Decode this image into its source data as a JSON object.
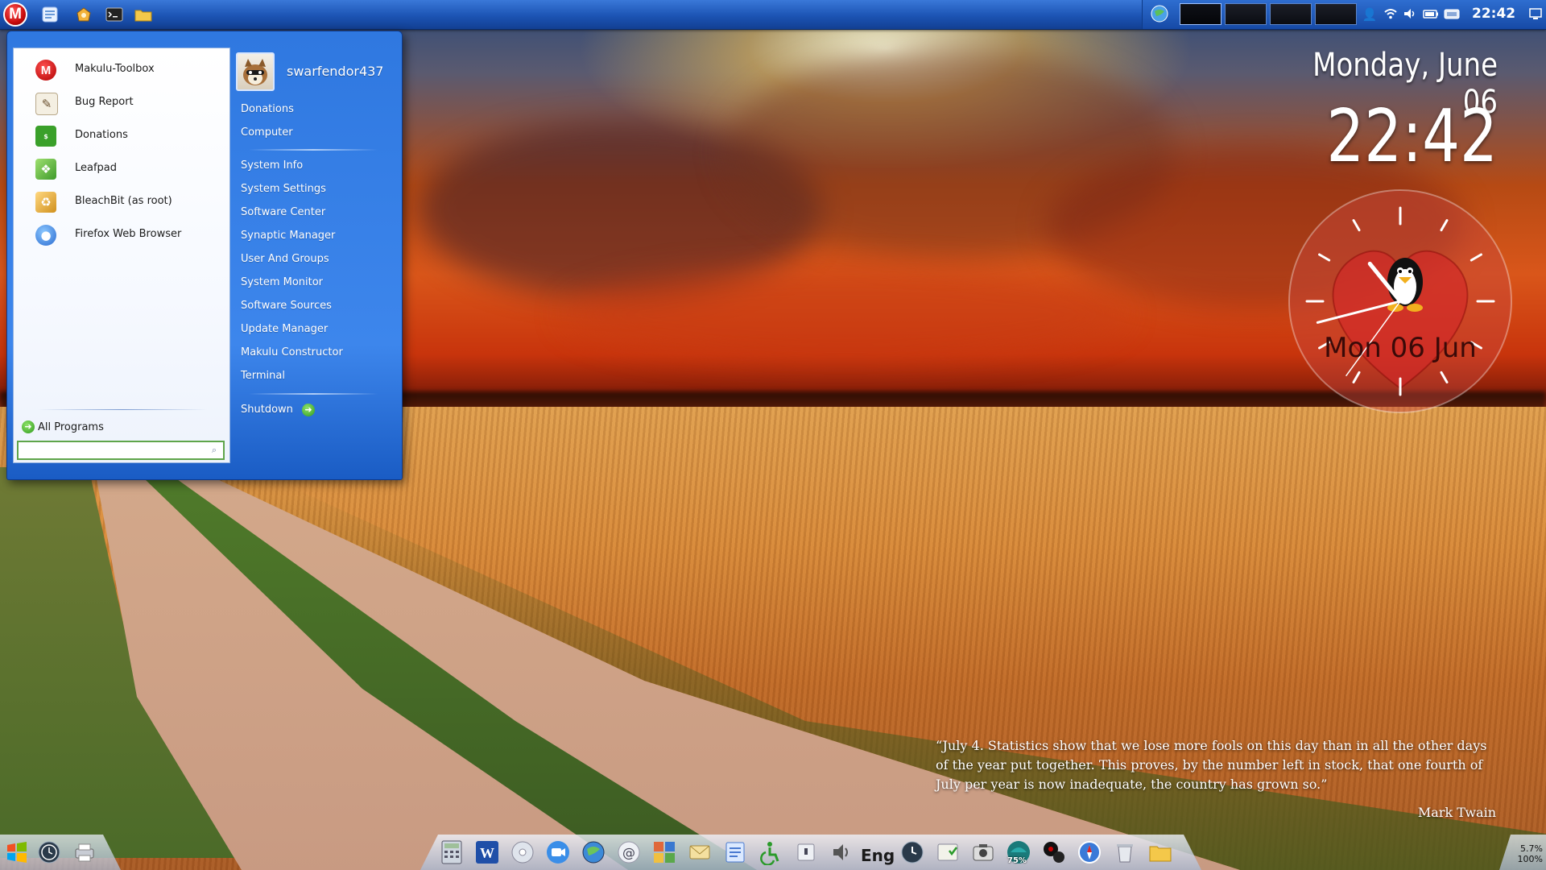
{
  "top_panel": {
    "menu_button_label": "M",
    "launchers": [
      "file-manager-icon",
      "toolbox-icon",
      "terminal-icon",
      "folder-icon"
    ],
    "workspaces_count": 4,
    "clock": "22:42"
  },
  "start_menu": {
    "apps": [
      {
        "label": "Makulu-Toolbox",
        "icon": "makulu-icon",
        "color": "#d11a1a"
      },
      {
        "label": "Bug Report",
        "icon": "bug-report-icon",
        "color": "#e8e2d4"
      },
      {
        "label": "Donations",
        "icon": "donations-icon",
        "color": "#3aa02a"
      },
      {
        "label": "Leafpad",
        "icon": "leafpad-icon",
        "color": "#6cc04a"
      },
      {
        "label": "BleachBit (as root)",
        "icon": "bleachbit-icon",
        "color": "#e0a83a"
      },
      {
        "label": "Firefox Web Browser",
        "icon": "firefox-icon",
        "color": "#3c8be0"
      }
    ],
    "all_programs_label": "All Programs",
    "search_value": "",
    "user_name": "swarfendor437",
    "places": [
      "Donations",
      "Computer"
    ],
    "system_items": [
      "System Info",
      "System Settings",
      "Software Center",
      "Synaptic Manager",
      "User And Groups",
      "System Monitor",
      "Software Sources",
      "Update Manager",
      "Makulu Constructor",
      "Terminal"
    ],
    "shutdown_label": "Shutdown"
  },
  "widgets": {
    "date": "Monday, June 06",
    "time": "22:42",
    "analog_clock": {
      "hour": 22,
      "minute": 42,
      "second": 36
    },
    "clock_date_label": "Mon 06 Jun",
    "quote": "“July 4. Statistics show that we lose more fools on this day than in all the other days of the year put together. This proves, by the number left in stock, that one fourth of July per year is now inadequate, the country has grown so.”",
    "quote_author": "Mark Twain"
  },
  "dock": {
    "keyboard_layout": "Eng",
    "battery_percent": "75%",
    "cpu": "5.7%",
    "mem": "100%"
  }
}
